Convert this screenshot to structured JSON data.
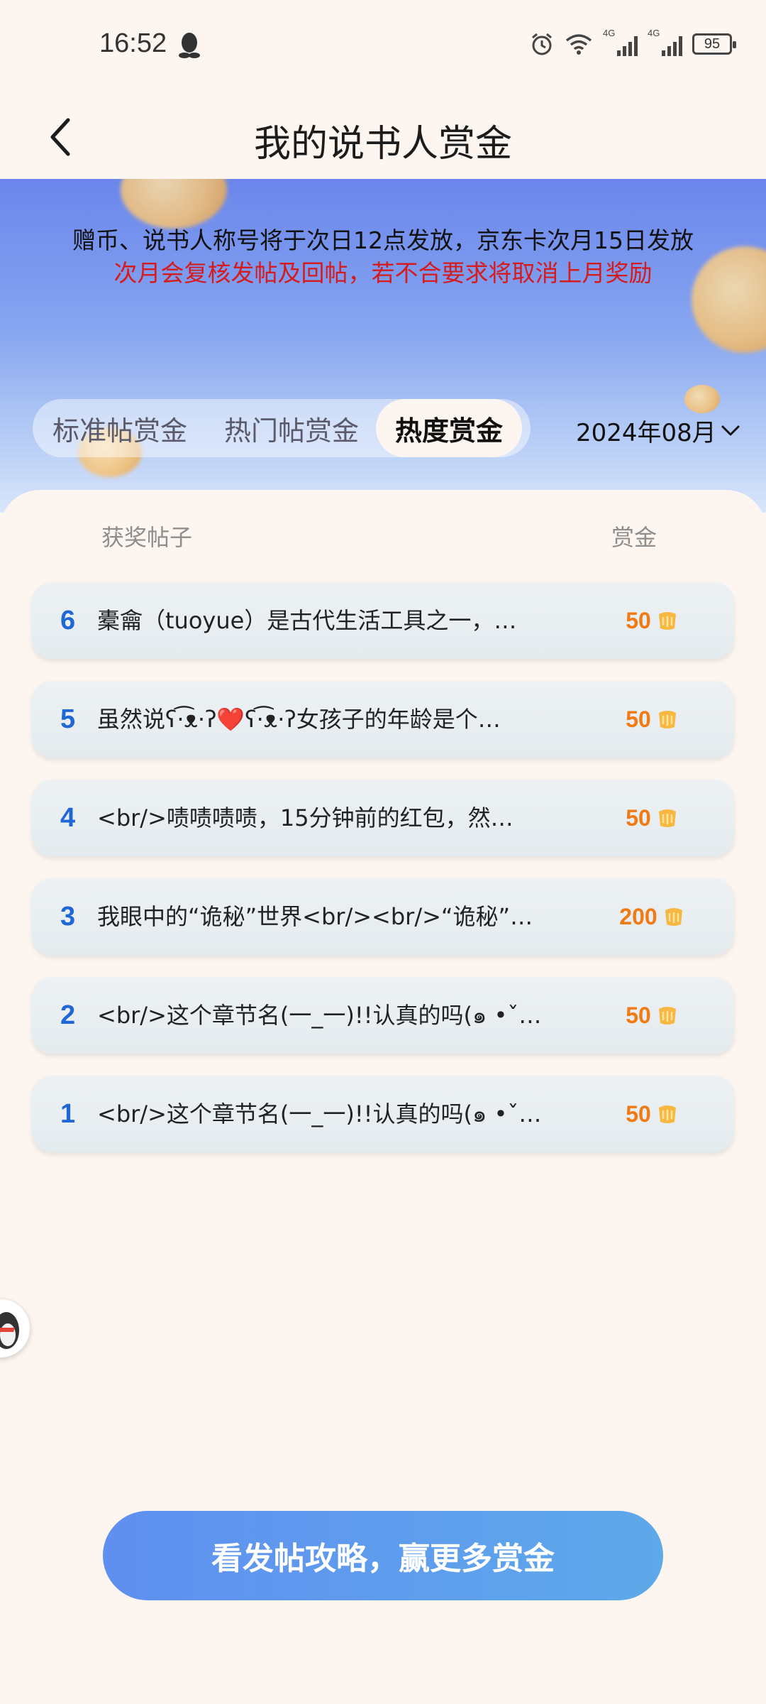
{
  "status_bar": {
    "time": "16:52",
    "battery": "95",
    "network_1": "4G",
    "network_2": "4G",
    "icons": [
      "qq-icon",
      "alarm-icon",
      "wifi-icon",
      "signal-icon",
      "signal-icon",
      "battery-icon"
    ]
  },
  "header": {
    "title": "我的说书人赏金",
    "back_icon": "chevron-left-icon"
  },
  "banner": {
    "notice_line1": "赠币、说书人称号将于次日12点发放，京东卡次月15日发放",
    "notice_line2": "次月会复核发帖及回帖，若不合要求将取消上月奖励",
    "notice_line2_color": "#d51b1b"
  },
  "tabs": [
    {
      "label": "标准帖赏金",
      "active": false
    },
    {
      "label": "热门帖赏金",
      "active": false
    },
    {
      "label": "热度赏金",
      "active": true
    }
  ],
  "month_select": {
    "value": "2024年08月",
    "icon": "chevron-down-icon"
  },
  "table": {
    "col_post": "获奖帖子",
    "col_reward": "赏金",
    "rows": [
      {
        "rank": "6",
        "title": "橐龠（tuoyue）是古代生活工具之一，…",
        "reward": "50"
      },
      {
        "rank": "5",
        "title": "虽然说ʕ·͡ᴥ·ʔ❤️ʕ·͡ᴥ·ʔ女孩子的年龄是个…",
        "reward": "50"
      },
      {
        "rank": "4",
        "title": "<br/>啧啧啧啧，15分钟前的红包，然…",
        "reward": "50"
      },
      {
        "rank": "3",
        "title": "我眼中的“诡秘”世界<br/><br/>“诡秘”…",
        "reward": "200"
      },
      {
        "rank": "2",
        "title": "<br/>这个章节名(一_一)!!认真的吗(๑ •ˇ…",
        "reward": "50"
      },
      {
        "rank": "1",
        "title": "<br/>这个章节名(一_一)!!认真的吗(๑ •ˇ…",
        "reward": "50"
      }
    ]
  },
  "cta": {
    "label": "看发帖攻略，赢更多赏金"
  },
  "colors": {
    "accent_blue": "#1f66d6",
    "reward_orange": "#f07a14",
    "background": "#fdf5ef",
    "cta_gradient_start": "#5f8ff0",
    "cta_gradient_end": "#5ea9ea"
  }
}
